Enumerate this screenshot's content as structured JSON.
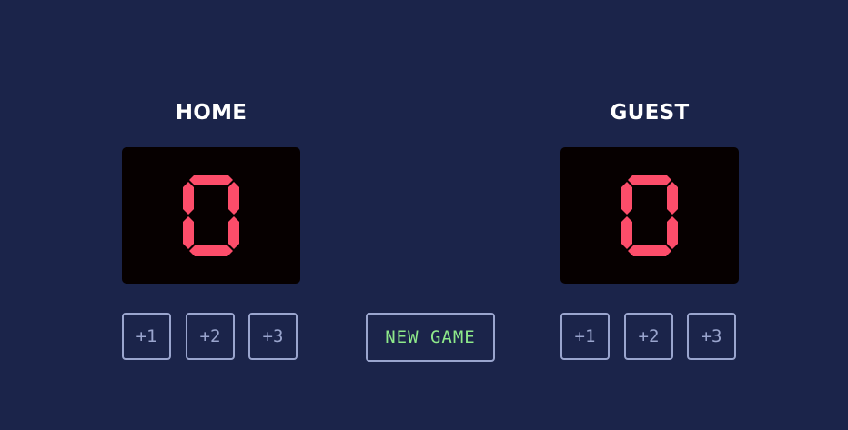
{
  "colors": {
    "background": "#1b244a",
    "score_bg": "#060000",
    "score_digit": "#fc4d6a",
    "button_border": "#9aa5ce",
    "new_game_text": "#8ee98a"
  },
  "home": {
    "title": "HOME",
    "score": "0",
    "buttons": [
      "+1",
      "+2",
      "+3"
    ]
  },
  "guest": {
    "title": "GUEST",
    "score": "0",
    "buttons": [
      "+1",
      "+2",
      "+3"
    ]
  },
  "new_game_label": "NEW GAME"
}
